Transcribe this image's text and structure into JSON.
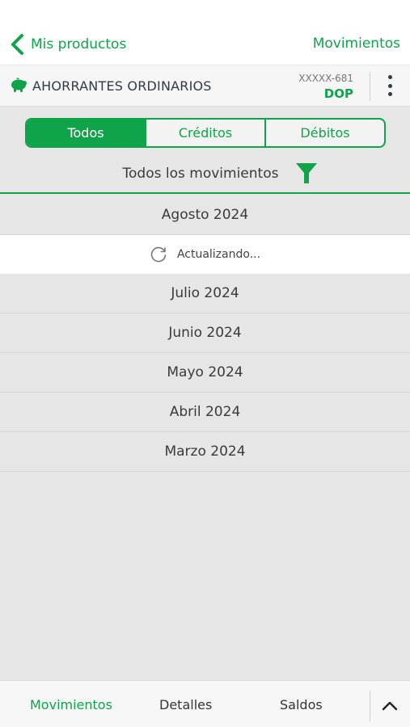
{
  "header": {
    "back_label": "Mis productos",
    "section_title": "Movimientos"
  },
  "account": {
    "icon": "piggy-bank-icon",
    "name": "AHORRANTES ORDINARIOS",
    "number": "XXXXX-681",
    "currency": "DOP"
  },
  "segments": {
    "items": [
      "Todos",
      "Créditos",
      "Débitos"
    ],
    "selected": "Todos"
  },
  "filter": {
    "label": "Todos los movimientos",
    "icon": "filter-icon"
  },
  "months": [
    "Agosto 2024",
    "Julio 2024",
    "Junio 2024",
    "Mayo 2024",
    "Abril 2024",
    "Marzo 2024"
  ],
  "loading_text": "Actualizando...",
  "bottom_tabs": {
    "items": [
      "Movimientos",
      "Detalles",
      "Saldos"
    ],
    "active": "Movimientos"
  },
  "colors": {
    "brand_green": "#0fa34a",
    "background": "#e6e6e6"
  }
}
